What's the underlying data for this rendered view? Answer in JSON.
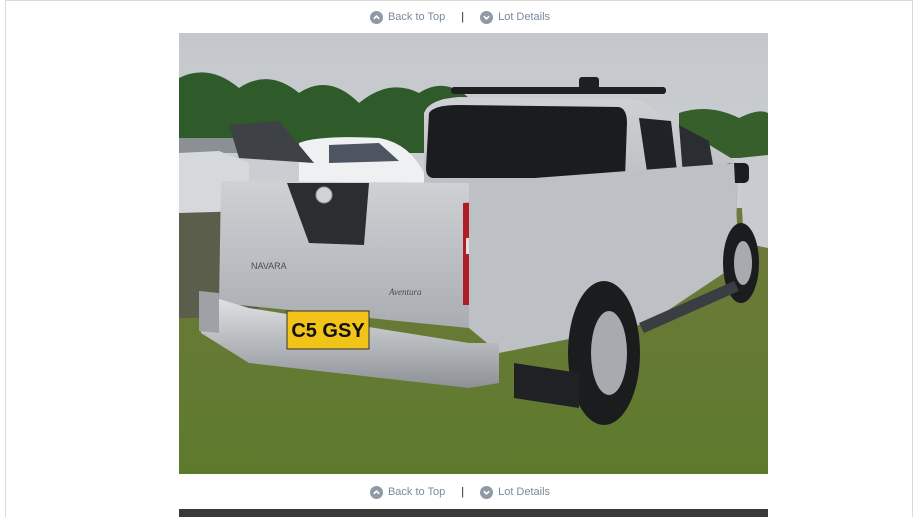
{
  "nav": {
    "back_to_top": "Back to Top",
    "separator": "|",
    "lot_details": "Lot Details"
  },
  "photo": {
    "plate_text": "C5 GSY",
    "badge_left": "NAVARA",
    "badge_right": "Aventura"
  },
  "colors": {
    "nav_text": "#7a8a9b",
    "nav_icon": "#8f9aa6",
    "border": "#d9d9d9"
  }
}
